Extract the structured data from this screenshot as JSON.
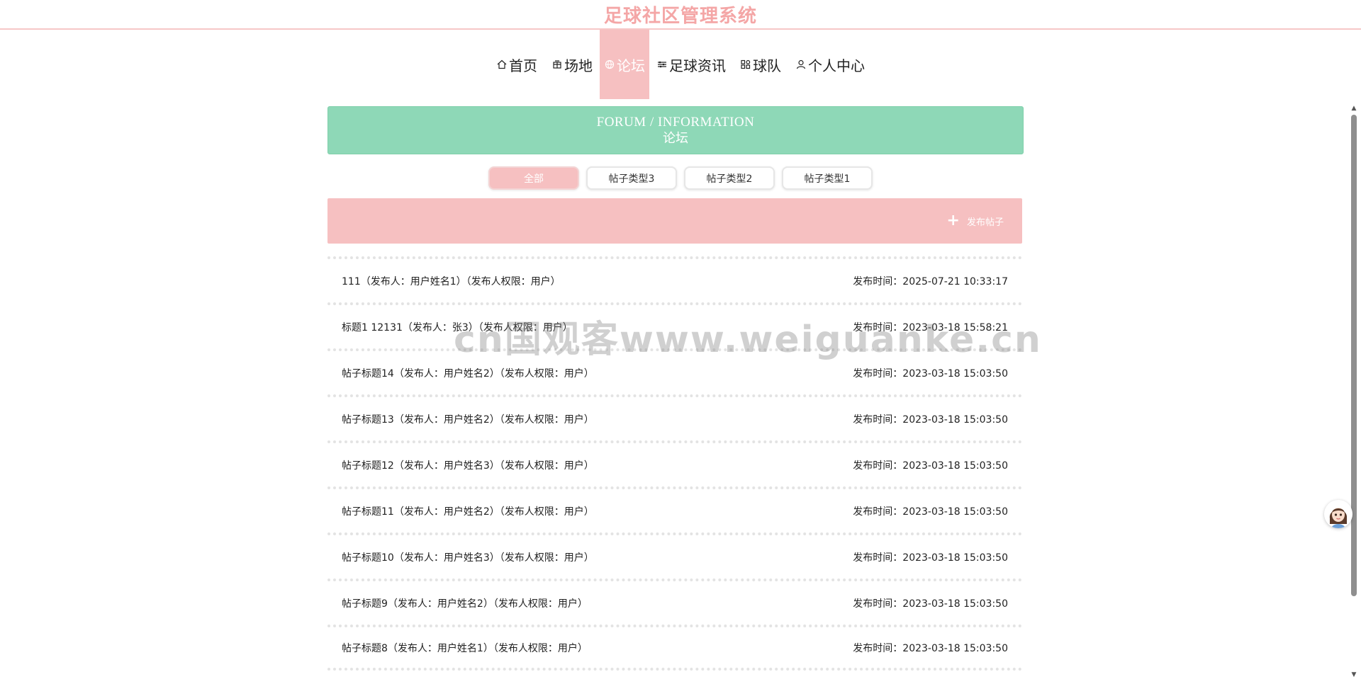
{
  "header": {
    "title": "足球社区管理系统"
  },
  "nav": {
    "items": [
      {
        "label": "首页",
        "icon": "home-icon"
      },
      {
        "label": "场地",
        "icon": "venue-icon"
      },
      {
        "label": "论坛",
        "icon": "forum-icon",
        "active": true
      },
      {
        "label": "足球资讯",
        "icon": "news-icon"
      },
      {
        "label": "球队",
        "icon": "team-icon"
      },
      {
        "label": "个人中心",
        "icon": "user-icon"
      }
    ]
  },
  "banner": {
    "english": "FORUM / INFORMATION",
    "chinese": "论坛"
  },
  "tabs": [
    {
      "label": "全部",
      "active": true
    },
    {
      "label": "帖子类型3"
    },
    {
      "label": "帖子类型2"
    },
    {
      "label": "帖子类型1"
    }
  ],
  "actions": {
    "post_label": "发布帖子"
  },
  "posts": [
    {
      "title": "111（发布人：用户姓名1）（发布人权限：用户）",
      "time": "发布时间：2025-07-21 10:33:17"
    },
    {
      "title": "标题1 12131（发布人：张3）（发布人权限：用户）",
      "time": "发布时间：2023-03-18 15:58:21"
    },
    {
      "title": "帖子标题14（发布人：用户姓名2）（发布人权限：用户）",
      "time": "发布时间：2023-03-18 15:03:50"
    },
    {
      "title": "帖子标题13（发布人：用户姓名2）（发布人权限：用户）",
      "time": "发布时间：2023-03-18 15:03:50"
    },
    {
      "title": "帖子标题12（发布人：用户姓名3）（发布人权限：用户）",
      "time": "发布时间：2023-03-18 15:03:50"
    },
    {
      "title": "帖子标题11（发布人：用户姓名2）（发布人权限：用户）",
      "time": "发布时间：2023-03-18 15:03:50"
    },
    {
      "title": "帖子标题10（发布人：用户姓名3）（发布人权限：用户）",
      "time": "发布时间：2023-03-18 15:03:50"
    },
    {
      "title": "帖子标题9（发布人：用户姓名2）（发布人权限：用户）",
      "time": "发布时间：2023-03-18 15:03:50"
    },
    {
      "title": "帖子标题8（发布人：用户姓名1）（发布人权限：用户）",
      "time": "发布时间：2023-03-18 15:03:50"
    }
  ],
  "watermark": {
    "text": "cn国观客www.weiguanke.cn"
  },
  "colors": {
    "accent_pink": "#f6c0c1",
    "title_pink": "#f4a6a6",
    "banner_green": "#8ed8b7"
  }
}
